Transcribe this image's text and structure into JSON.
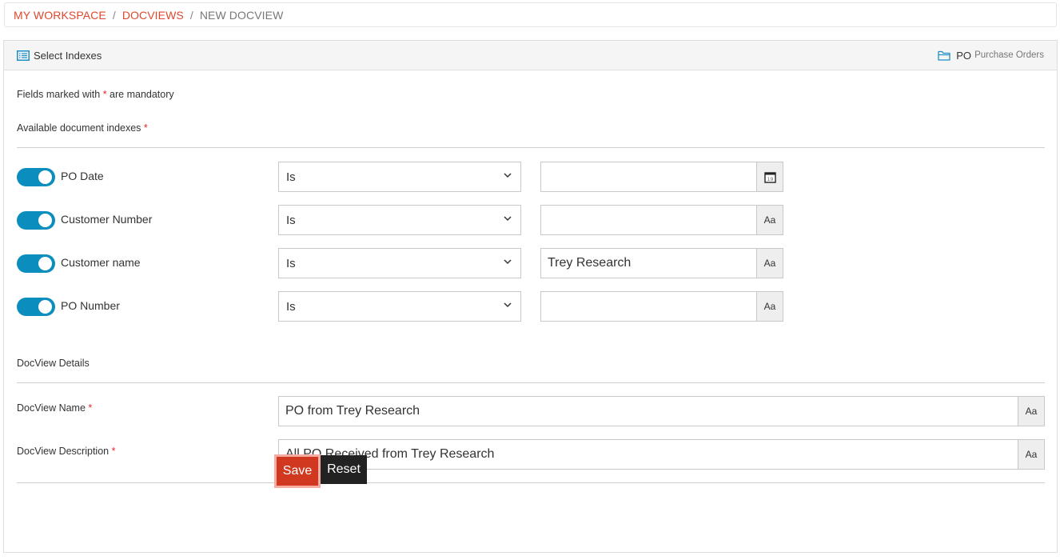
{
  "breadcrumb": {
    "items": [
      {
        "label": "MY WORKSPACE",
        "link": true
      },
      {
        "label": "DOCVIEWS",
        "link": true
      },
      {
        "label": "NEW DOCVIEW",
        "link": false
      }
    ],
    "separator": "/"
  },
  "panel": {
    "title": "Select Indexes",
    "title_icon": "list-icon",
    "repository_code": "PO",
    "repository_name": "Purchase Orders",
    "repository_icon": "folder-icon"
  },
  "form": {
    "mandatory_note_prefix": "Fields marked with",
    "mandatory_note_suffix": "are mandatory",
    "required_mark": "*",
    "indexes_heading": "Available document indexes",
    "indexes": [
      {
        "label": "PO Date",
        "enabled": true,
        "operator": "Is",
        "value": "",
        "addon": "calendar-icon",
        "addon_text": "19"
      },
      {
        "label": "Customer Number",
        "enabled": true,
        "operator": "Is",
        "value": "",
        "addon": "text-type-icon",
        "addon_text": "Aa"
      },
      {
        "label": "Customer name",
        "enabled": true,
        "operator": "Is",
        "value": "Trey Research",
        "addon": "text-type-icon",
        "addon_text": "Aa"
      },
      {
        "label": "PO Number",
        "enabled": true,
        "operator": "Is",
        "value": "",
        "addon": "text-type-icon",
        "addon_text": "Aa"
      }
    ],
    "details_heading": "DocView Details",
    "docview_name_label": "DocView Name",
    "docview_name_value": "PO from Trey Research",
    "docview_description_label": "DocView Description",
    "docview_description_value": "All PO Received from Trey Research",
    "addon_text": "Aa"
  },
  "actions": {
    "save_label": "Save",
    "reset_label": "Reset"
  },
  "colors": {
    "accent": "#e0482e",
    "toggle_on": "#0b8ebd",
    "save_button": "#d0391f",
    "reset_button": "#222222"
  }
}
